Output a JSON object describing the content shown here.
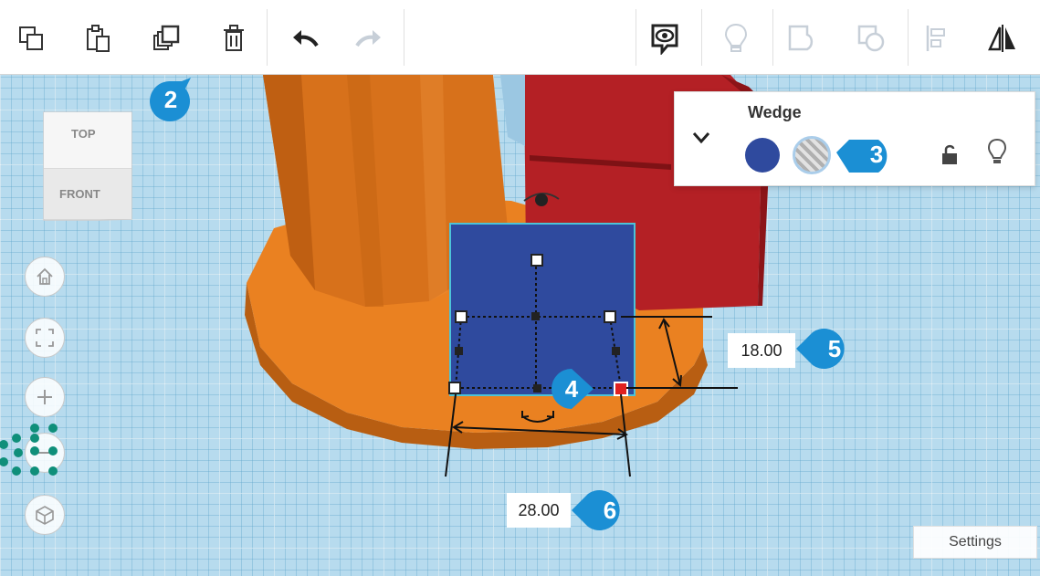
{
  "toolbar": {
    "left_tools": [
      {
        "name": "copy",
        "icon": "copy-icon"
      },
      {
        "name": "paste",
        "icon": "paste-icon"
      },
      {
        "name": "duplicate",
        "icon": "duplicate-icon"
      },
      {
        "name": "delete",
        "icon": "trash-icon"
      }
    ],
    "history_tools": [
      {
        "name": "undo",
        "icon": "undo-arrow-icon"
      },
      {
        "name": "redo",
        "icon": "redo-arrow-icon",
        "disabled": true
      }
    ],
    "right_tools": [
      {
        "name": "notes",
        "icon": "comment-eye-icon"
      },
      {
        "name": "show-all",
        "icon": "lightbulb-icon",
        "disabled": true
      },
      {
        "name": "group",
        "icon": "group-icon",
        "disabled": true
      },
      {
        "name": "ungroup",
        "icon": "ungroup-icon",
        "disabled": true
      },
      {
        "name": "align",
        "icon": "align-icon",
        "disabled": true
      },
      {
        "name": "mirror",
        "icon": "mirror-icon"
      }
    ]
  },
  "viewcube": {
    "top": "TOP",
    "front": "FRONT"
  },
  "nav_controls": [
    {
      "name": "home-view",
      "icon": "home-icon"
    },
    {
      "name": "fit-all",
      "icon": "fit-view-icon"
    },
    {
      "name": "zoom-in",
      "icon": "plus-icon"
    },
    {
      "name": "zoom-out",
      "icon": "minus-icon"
    },
    {
      "name": "perspective",
      "icon": "cube-perspective-icon"
    }
  ],
  "inspector": {
    "title": "Wedge",
    "solid_color": "#2f4a9e",
    "hole_label": "Hole",
    "icons": [
      "chevron-down-icon",
      "lock-open-icon",
      "lightbulb-icon"
    ]
  },
  "dimensions": {
    "height": "18.00",
    "length": "28.00"
  },
  "callouts": {
    "c2": "2",
    "c3": "3",
    "c4": "4",
    "c5": "5",
    "c6": "6"
  },
  "settings_label": "Settings",
  "colors": {
    "accent_blue": "#1b8fd4",
    "shape_blue": "#2f4a9e",
    "orange": "#e8801f",
    "red": "#b42025",
    "grid": "#b7dbee",
    "handle_red": "#e02020",
    "teal_dots": "#0f8f7a"
  }
}
